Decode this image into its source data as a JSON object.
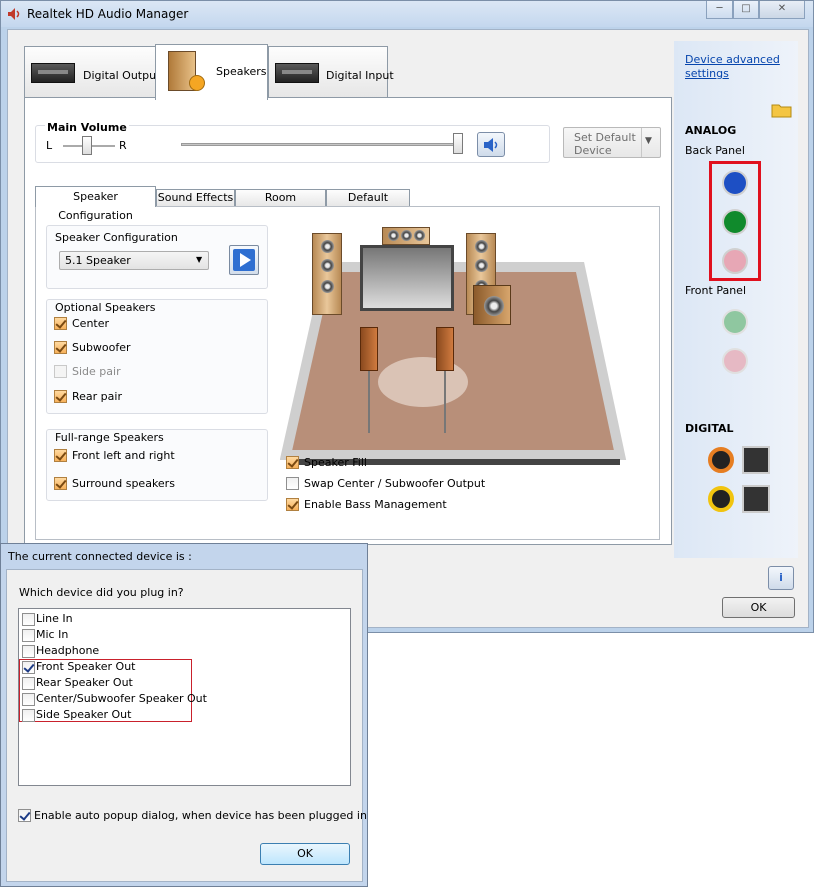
{
  "window": {
    "title": "Realtek HD Audio Manager"
  },
  "tabs": [
    {
      "label": "Digital Output"
    },
    {
      "label": "Speakers"
    },
    {
      "label": "Digital Input"
    }
  ],
  "side": {
    "device_advanced": "Device advanced settings",
    "analog": "ANALOG",
    "back_panel": "Back Panel",
    "front_panel": "Front Panel",
    "digital": "DIGITAL"
  },
  "volume": {
    "label": "Main Volume",
    "left": "L",
    "right": "R",
    "set_default": "Set Default Device"
  },
  "subtabs": [
    {
      "label": "Speaker Configuration"
    },
    {
      "label": "Sound Effects"
    },
    {
      "label": "Room Correction"
    },
    {
      "label": "Default Format"
    }
  ],
  "config": {
    "group_label": "Speaker Configuration",
    "selected": "5.1 Speaker"
  },
  "optional": {
    "label": "Optional Speakers",
    "items": [
      {
        "label": "Center"
      },
      {
        "label": "Subwoofer"
      },
      {
        "label": "Side pair"
      },
      {
        "label": "Rear pair"
      }
    ]
  },
  "fullrange": {
    "label": "Full-range Speakers",
    "items": [
      {
        "label": "Front left and right"
      },
      {
        "label": "Surround speakers"
      }
    ]
  },
  "options": [
    {
      "label": "Speaker Fill"
    },
    {
      "label": "Swap Center / Subwoofer Output"
    },
    {
      "label": "Enable Bass Management"
    }
  ],
  "main_ok": "OK",
  "dialog": {
    "title": "The current connected device is :",
    "question": "Which device did you plug in?",
    "items": [
      {
        "label": "Line In"
      },
      {
        "label": "Mic In"
      },
      {
        "label": "Headphone"
      },
      {
        "label": "Front Speaker Out"
      },
      {
        "label": "Rear Speaker Out"
      },
      {
        "label": "Center/Subwoofer Speaker Out"
      },
      {
        "label": "Side Speaker Out"
      }
    ],
    "auto_popup": "Enable auto popup dialog, when device has been plugged in",
    "ok": "OK"
  },
  "colors": {
    "highlight_red": "#e0101e",
    "jack_blue": "#1d4fc4",
    "jack_green": "#108a2c",
    "jack_pink": "#e7a7b5"
  }
}
